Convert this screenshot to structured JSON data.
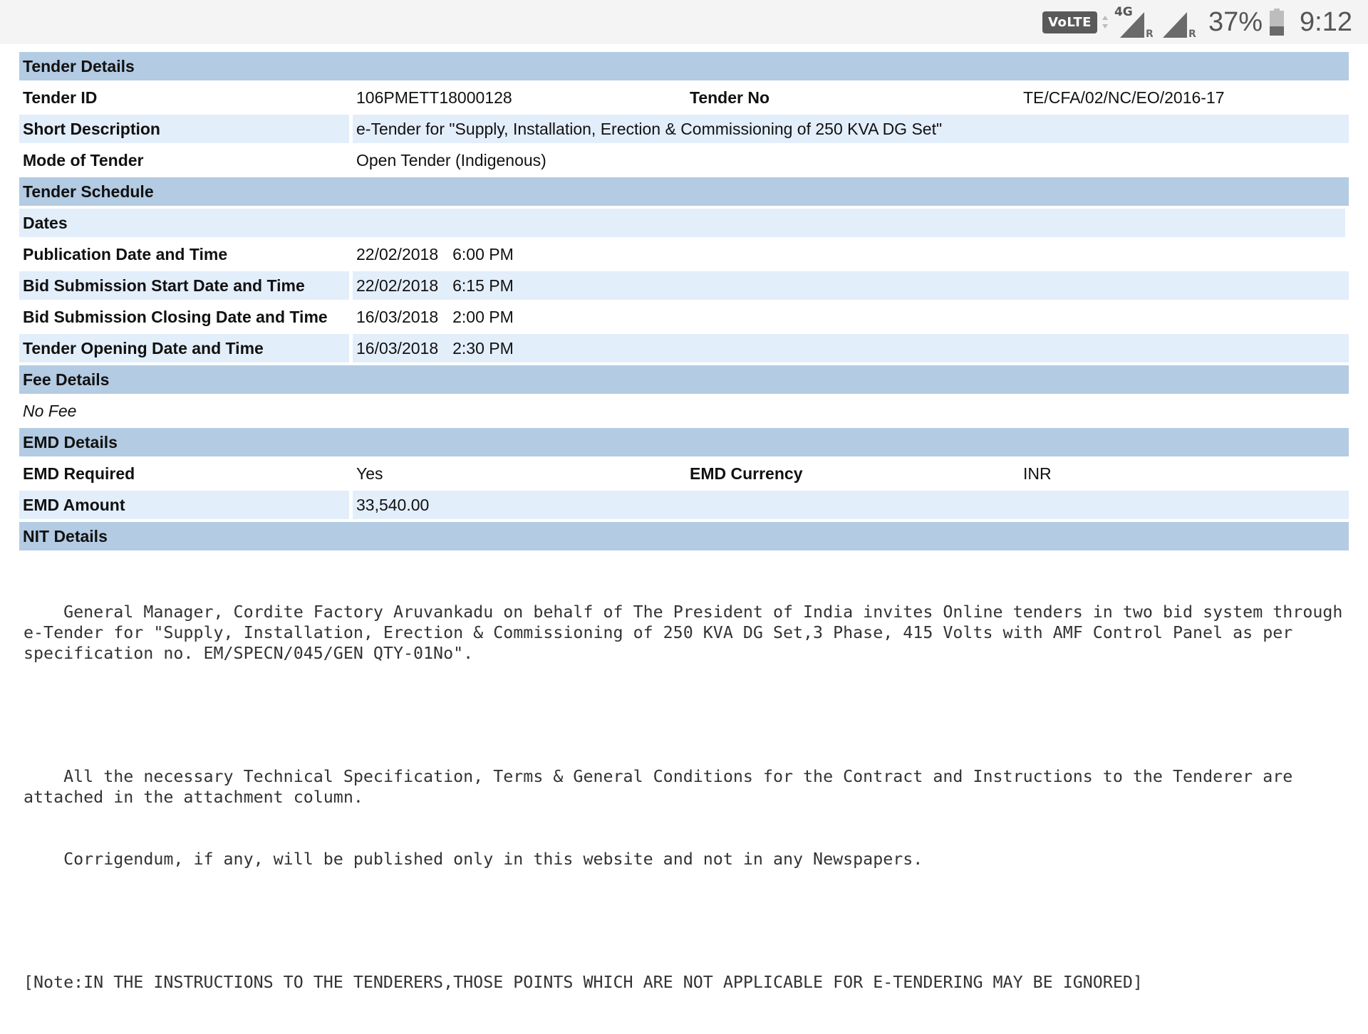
{
  "status_bar": {
    "volte": "VoLTE",
    "network": "4G",
    "roaming": "R",
    "battery": "37%",
    "battery_level": 0.37,
    "time": "9:12"
  },
  "tender_details": {
    "heading": "Tender Details",
    "tender_id_label": "Tender ID",
    "tender_id": "106PMETT18000128",
    "tender_no_label": "Tender No",
    "tender_no": "TE/CFA/02/NC/EO/2016-17",
    "short_desc_label": "Short Description",
    "short_desc": "e-Tender for \"Supply, Installation, Erection & Commissioning of 250 KVA DG Set\"",
    "mode_label": "Mode of Tender",
    "mode": "Open Tender (Indigenous)"
  },
  "tender_schedule": {
    "heading": "Tender Schedule",
    "dates_label": "Dates",
    "rows": [
      {
        "label": "Publication Date and Time",
        "date": "22/02/2018",
        "time": "6:00 PM"
      },
      {
        "label": "Bid Submission Start Date and Time",
        "date": "22/02/2018",
        "time": "6:15 PM"
      },
      {
        "label": "Bid Submission Closing Date and Time",
        "date": "16/03/2018",
        "time": "2:00 PM"
      },
      {
        "label": "Tender Opening Date and Time",
        "date": "16/03/2018",
        "time": "2:30 PM"
      }
    ]
  },
  "fee_details": {
    "heading": "Fee Details",
    "value": "No Fee"
  },
  "emd_details": {
    "heading": "EMD Details",
    "required_label": "EMD Required",
    "required": "Yes",
    "currency_label": "EMD Currency",
    "currency": "INR",
    "amount_label": "EMD Amount",
    "amount": "33,540.00"
  },
  "nit_details": {
    "heading": "NIT Details",
    "paragraph1": "    General Manager, Cordite Factory Aruvankadu on behalf of The President of India invites Online tenders in two bid system through e-Tender for \"Supply, Installation, Erection & Commissioning of 250 KVA DG Set,3 Phase, 415 Volts with AMF Control Panel as per specification no. EM/SPECN/045/GEN QTY-01No\".",
    "paragraph2": "    All the necessary Technical Specification, Terms & General Conditions for the Contract and Instructions to the Tenderer are attached in the attachment column.",
    "paragraph3": "    Corrigendum, if any, will be published only in this website and not in any Newspapers.",
    "note": "[Note:IN THE INSTRUCTIONS TO THE TENDERERS,THOSE POINTS WHICH ARE NOT APPLICABLE FOR E-TENDERING MAY BE IGNORED]"
  }
}
